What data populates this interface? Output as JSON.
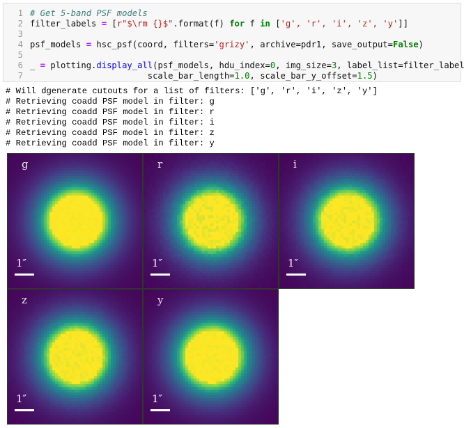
{
  "code_cell": {
    "lines": [
      {
        "number": "1",
        "comment": "# Get 5-band PSF models"
      },
      {
        "number": "2",
        "var": "filter_labels",
        "eq": " = ",
        "rest_a": "[",
        "str_a": "r\"$\\rm {}$\"",
        "rest_b": ".format(f) ",
        "kw_for": "for",
        "rest_c": " f ",
        "kw_in": "in",
        "rest_d": " [",
        "str_list": "'g', 'r', 'i', 'z', 'y'",
        "rest_e": "]]"
      },
      {
        "number": "3"
      },
      {
        "number": "4",
        "var": "psf_models",
        "eq": " = ",
        "rest_a": "hsc_psf(coord, filters=",
        "str_a": "'grizy'",
        "rest_b": ", archive=pdr1, save_output=",
        "kw_false": "False",
        "rest_c": ")"
      },
      {
        "number": "5"
      },
      {
        "number": "6",
        "var": "_",
        "eq": " = ",
        "rest_a": "plotting.",
        "fn": "display_all",
        "rest_b": "(psf_models, hdu_index=",
        "n0": "0",
        "rest_c": ", img_size=",
        "n3": "3",
        "rest_d": ", label_list=filter_labels,"
      },
      {
        "number": "7",
        "rest_a": "                       scale_bar_length=",
        "n1": "1.0",
        "rest_b": ", scale_bar_y_offset=",
        "n15": "1.5",
        "rest_c": ")"
      }
    ]
  },
  "output_lines": [
    "# Will dgenerate cutouts for a list of filters: ['g', 'r', 'i', 'z', 'y']",
    "# Retrieving coadd PSF model in filter: g",
    "# Retrieving coadd PSF model in filter: r",
    "# Retrieving coadd PSF model in filter: i",
    "# Retrieving coadd PSF model in filter: z",
    "# Retrieving coadd PSF model in filter: y"
  ],
  "psf_panels": [
    {
      "band": "g",
      "scale_label": "1″",
      "noise": 0.25
    },
    {
      "band": "r",
      "scale_label": "1″",
      "noise": 1.0
    },
    {
      "band": "i",
      "scale_label": "1″",
      "noise": 0.75
    },
    {
      "band": "z",
      "scale_label": "1″",
      "noise": 0.6
    },
    {
      "band": "y",
      "scale_label": "1″",
      "noise": 0.4
    }
  ],
  "colors": {
    "psf_background": "#440154",
    "psf_core": "#fde725",
    "comment": "#408080",
    "keyword": "#008000",
    "string": "#ba2121",
    "line_number": "#999999"
  }
}
